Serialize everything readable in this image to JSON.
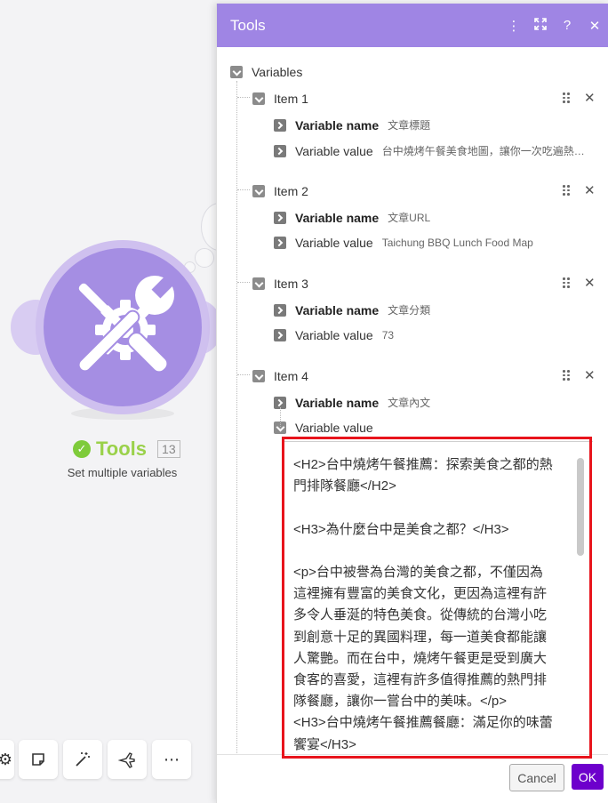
{
  "module": {
    "name": "Tools",
    "number": "13",
    "description": "Set multiple variables"
  },
  "panel": {
    "title": "Tools"
  },
  "variables_label": "Variables",
  "items": [
    {
      "label": "Item 1",
      "name_label": "Variable name",
      "name": "文章標題",
      "value_label": "Variable value",
      "value": "台中燒烤午餐美食地圖，讓你一次吃遍熱門排隊餐廳"
    },
    {
      "label": "Item 2",
      "name_label": "Variable name",
      "name": "文章URL",
      "value_label": "Variable value",
      "value": "Taichung BBQ Lunch Food Map"
    },
    {
      "label": "Item 3",
      "name_label": "Variable name",
      "name": "文章分類",
      "value_label": "Variable value",
      "value": "73"
    },
    {
      "label": "Item 4",
      "name_label": "Variable name",
      "name": "文章內文",
      "value_label": "Variable value",
      "value": "<H2>台中燒烤午餐推薦：探索美食之都的熱門排隊餐廳</H2>\n\n<H3>為什麼台中是美食之都？</H3>\n\n<p>台中被譽為台灣的美食之都，不僅因為這裡擁有豐富的美食文化，更因為這裡有許多令人垂涎的特色美食。從傳統的台灣小吃到創意十足的異國料理，每一道美食都能讓人驚艷。而在台中，燒烤午餐更是受到廣大食客的喜愛，這裡有許多值得推薦的熱門排隊餐廳，讓你一嘗台中的美味。</p>\n<H3>台中燒烤午餐推薦餐廳：滿足你的味蕾饗宴</H3>"
    }
  ],
  "footer": {
    "cancel": "Cancel",
    "ok": "OK"
  },
  "colors": {
    "header": "#9f85e4",
    "ok_button": "#6d00cc",
    "highlight": "#e8141c",
    "module": "#a58ee3",
    "status": "#9ad14a"
  }
}
